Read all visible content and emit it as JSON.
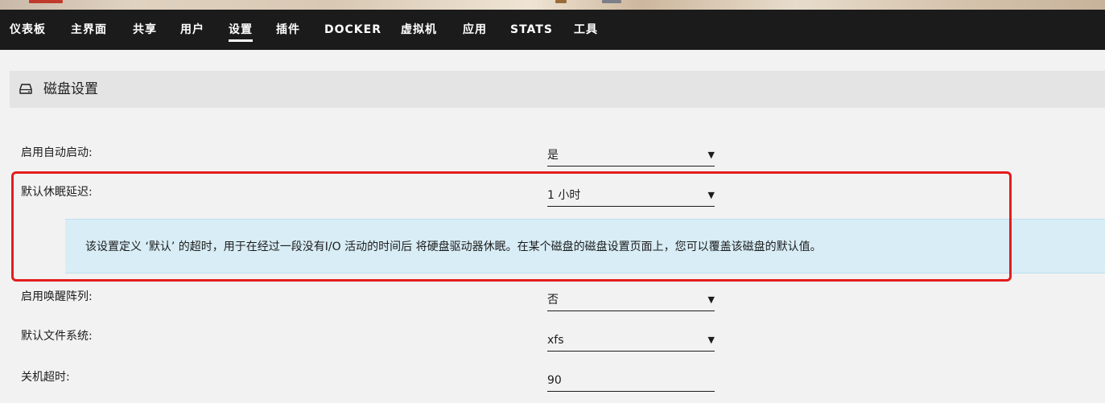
{
  "nav": {
    "items": [
      {
        "label": "仪表板"
      },
      {
        "label": "主界面"
      },
      {
        "label": "共享"
      },
      {
        "label": "用户"
      },
      {
        "label": "设置",
        "active": true
      },
      {
        "label": "插件"
      },
      {
        "label": "DOCKER"
      },
      {
        "label": "虚拟机"
      },
      {
        "label": "应用"
      },
      {
        "label": "STATS"
      },
      {
        "label": "工具"
      }
    ]
  },
  "section": {
    "icon": "hard-drive-icon",
    "title": "磁盘设置"
  },
  "settings": [
    {
      "label": "启用自动启动:",
      "value": "是",
      "control": "select"
    },
    {
      "label": "默认休眠延迟:",
      "value": "1 小时",
      "control": "select"
    },
    {
      "label": "启用唤醒阵列:",
      "value": "否",
      "control": "select"
    },
    {
      "label": "默认文件系统:",
      "value": "xfs",
      "control": "select"
    },
    {
      "label": "关机超时:",
      "value": "90",
      "control": "input"
    }
  ],
  "help": {
    "text": "该设置定义 ‘默认’ 的超时，用于在经过一段没有I/O 活动的时间后 将硬盘驱动器休眠。在某个磁盘的磁盘设置页面上，您可以覆盖该磁盘的默认值。"
  },
  "colors": {
    "navbar_bg": "#1c1b1b",
    "page_bg": "#f2f2f2",
    "info_bg": "#d8edf6",
    "highlight_border": "#e31d1d"
  }
}
